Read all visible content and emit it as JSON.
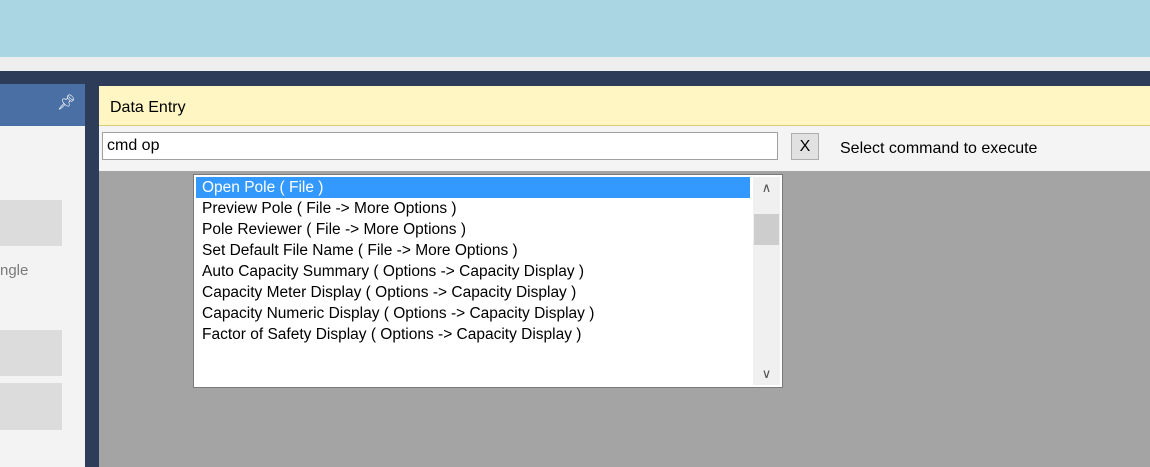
{
  "left_panel": {
    "pin_icon": "pin-icon",
    "fragment_label": "ngle"
  },
  "data_entry": {
    "title": "Data Entry",
    "input_value": "cmd op",
    "clear_label": "X",
    "status": "Select command to execute"
  },
  "suggestions": [
    {
      "label": "Open Pole   ( File )",
      "selected": true
    },
    {
      "label": "Preview Pole   ( File -> More Options )",
      "selected": false
    },
    {
      "label": "Pole Reviewer   ( File -> More Options )",
      "selected": false
    },
    {
      "label": "Set Default File Name   ( File -> More Options )",
      "selected": false
    },
    {
      "label": "Auto Capacity Summary   ( Options -> Capacity Display )",
      "selected": false
    },
    {
      "label": "Capacity Meter Display   ( Options -> Capacity Display )",
      "selected": false
    },
    {
      "label": "Capacity Numeric Display   ( Options -> Capacity Display )",
      "selected": false
    },
    {
      "label": "Factor of Safety Display   ( Options -> Capacity Display )",
      "selected": false
    }
  ],
  "colors": {
    "accent_selection": "#3399ff",
    "header_bg": "#fff6c4",
    "frame": "#2d3c58",
    "top_bar": "#aad6e3"
  }
}
